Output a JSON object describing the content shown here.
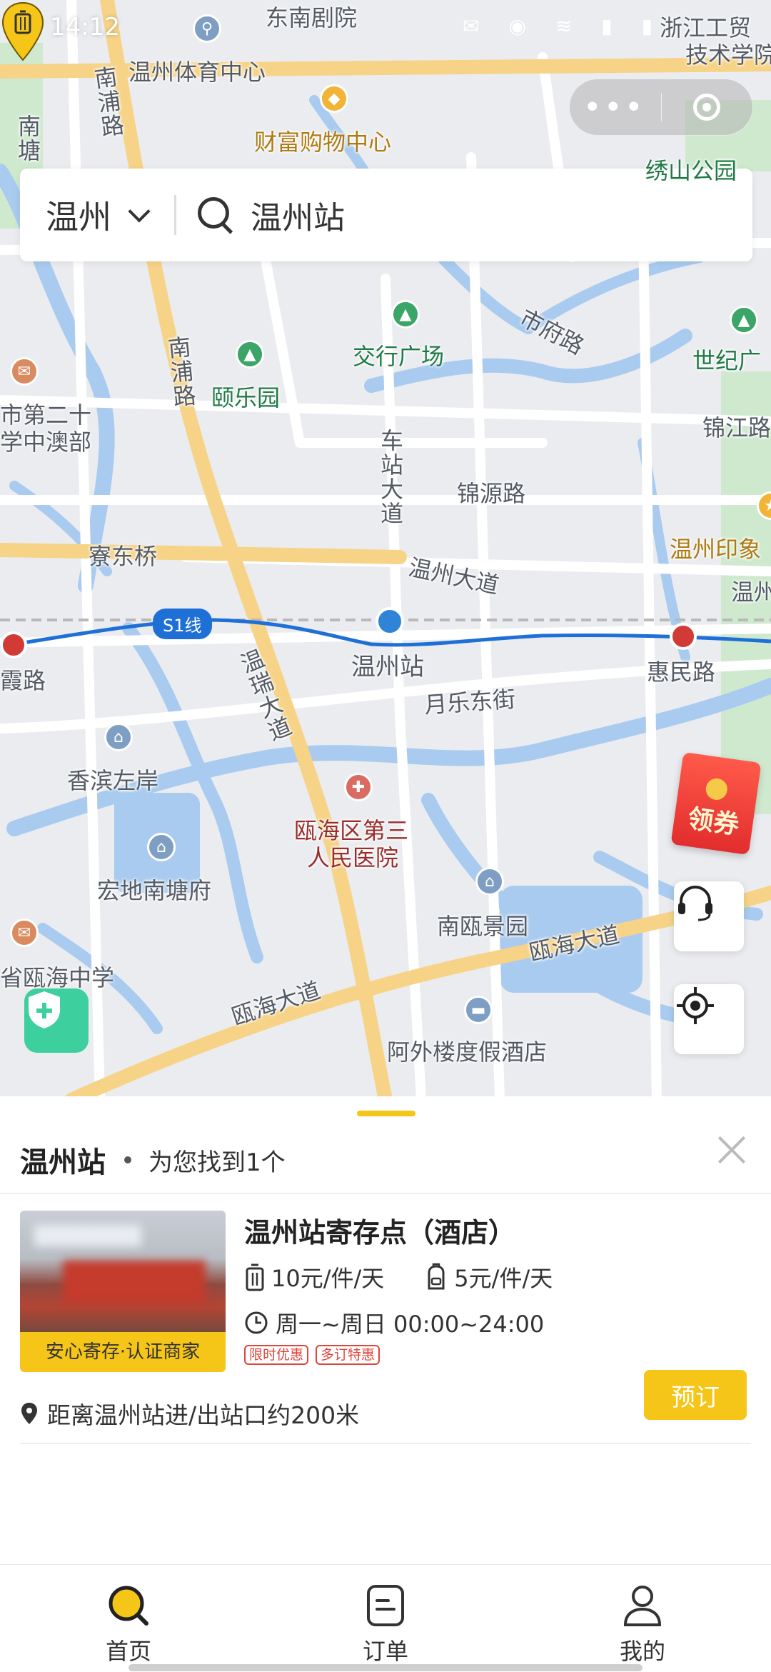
{
  "status_bar": {
    "time": "14:12"
  },
  "search": {
    "city": "温州",
    "query": "温州站"
  },
  "map": {
    "labels": {
      "dongnan_theater": "东南剧院",
      "sports_center": "温州体育中心",
      "wealth_mall": "财富购物中心",
      "nanpu_road_top": "南浦路",
      "nantang": "南塘",
      "zhejiang_college": "浙江工贸",
      "zhejiang_college2": "技术学院",
      "xiushan_park": "绣山公园",
      "bank_square": "交行广场",
      "shifu_road": "市府路",
      "century_square": "世纪广",
      "jinjiang_road": "锦江路",
      "yile_garden": "颐乐园",
      "nanpu_road_mid": "南浦路",
      "school_line1": "市第二十",
      "school_line2": "学中澳部",
      "station_ave_vertical": "车站大道",
      "jinyuan_road": "锦源路",
      "wenzhou_ave": "温州大道",
      "wenzhou_impression": "温州印象",
      "wenzhou_right": "温州",
      "liaodong_bridge": "寮东桥",
      "s1_line": "S1线",
      "wenzhou_station": "温州站",
      "huimin_road": "惠民路",
      "xia_road": "霞路",
      "yuele_east_street": "月乐东街",
      "xiangbin": "香滨左岸",
      "wenrui_ave": "温瑞大道",
      "hospital_line1": "瓯海区第三",
      "hospital_line2": "人民医院",
      "hongdi": "宏地南塘府",
      "nanou": "南瓯景园",
      "ouhai_ave_right": "瓯海大道",
      "ouhai_ave_left": "瓯海大道",
      "ouhai_school": "省瓯海中学",
      "awai_resort": "阿外楼度假酒店"
    }
  },
  "coupon": {
    "label": "领券"
  },
  "results": {
    "place": "温州站",
    "count_text": "为您找到1个"
  },
  "store": {
    "name": "温州站寄存点（酒店）",
    "badge": "安心寄存·认证商家",
    "price_luggage": "10元/件/天",
    "price_bag": "5元/件/天",
    "hours": "周一~周日 00:00~24:00",
    "tags": [
      "限时优惠",
      "多订特惠"
    ],
    "distance": "距离温州站进/出站口约200米",
    "book_label": "预订"
  },
  "tabs": [
    {
      "label": "首页",
      "icon": "home-search-icon"
    },
    {
      "label": "订单",
      "icon": "order-icon"
    },
    {
      "label": "我的",
      "icon": "profile-icon"
    }
  ],
  "colors": {
    "accent": "#f5c518",
    "metro_line": "#1e6fd6",
    "marker": "#2f84d8"
  }
}
